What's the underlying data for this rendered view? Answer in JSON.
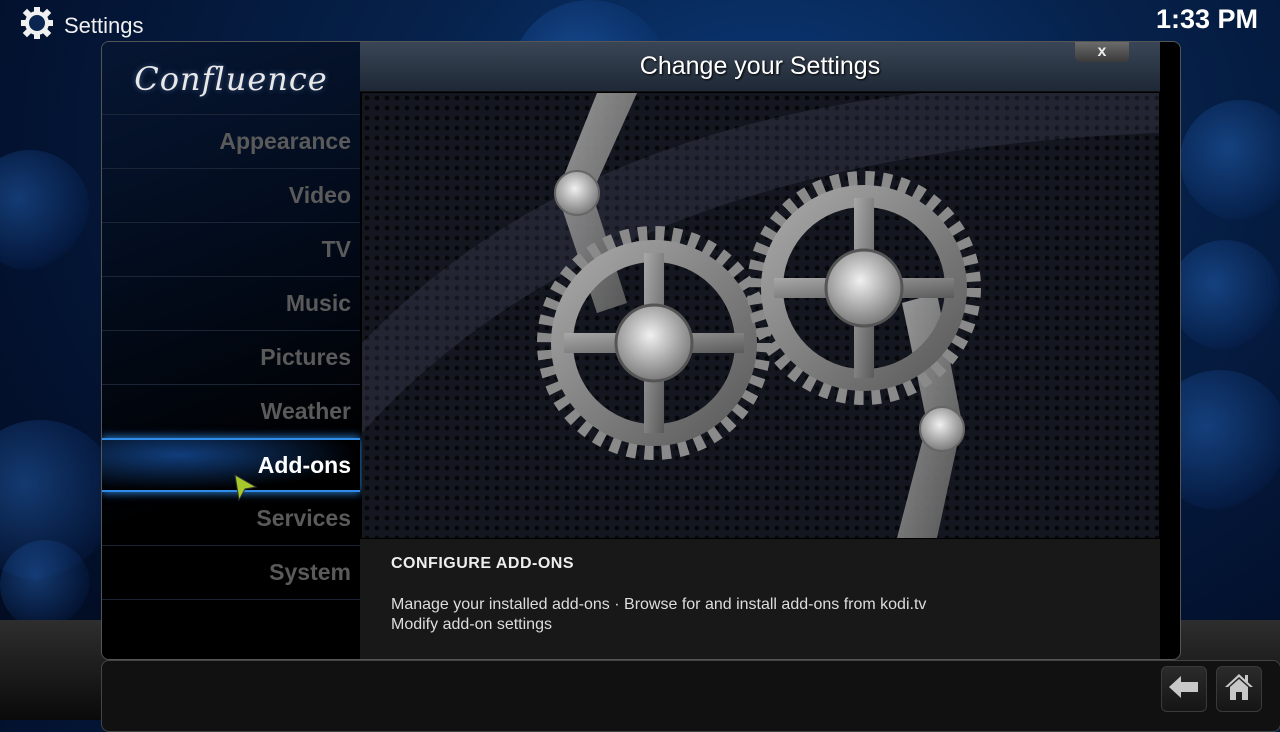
{
  "header": {
    "app_title": "Settings",
    "clock": "1:33 PM",
    "settings_icon": "gear-icon"
  },
  "panel": {
    "logo_text": "Confluence",
    "title": "Change your Settings",
    "close_label": "x"
  },
  "sidebar": {
    "items": [
      {
        "label": "Appearance",
        "active": false
      },
      {
        "label": "Video",
        "active": false
      },
      {
        "label": "TV",
        "active": false
      },
      {
        "label": "Music",
        "active": false
      },
      {
        "label": "Pictures",
        "active": false
      },
      {
        "label": "Weather",
        "active": false
      },
      {
        "label": "Add-ons",
        "active": true
      },
      {
        "label": "Services",
        "active": false
      },
      {
        "label": "System",
        "active": false
      }
    ]
  },
  "description": {
    "title": "CONFIGURE ADD-ONS",
    "line1": "Manage your installed add-ons · Browse for and install add-ons from kodi.tv",
    "line2": "Modify add-on settings"
  },
  "footer": {
    "back_icon": "back-arrow-icon",
    "home_icon": "home-icon"
  },
  "colors": {
    "accent": "#2f8ce8",
    "cursor": "#a6c82a"
  }
}
